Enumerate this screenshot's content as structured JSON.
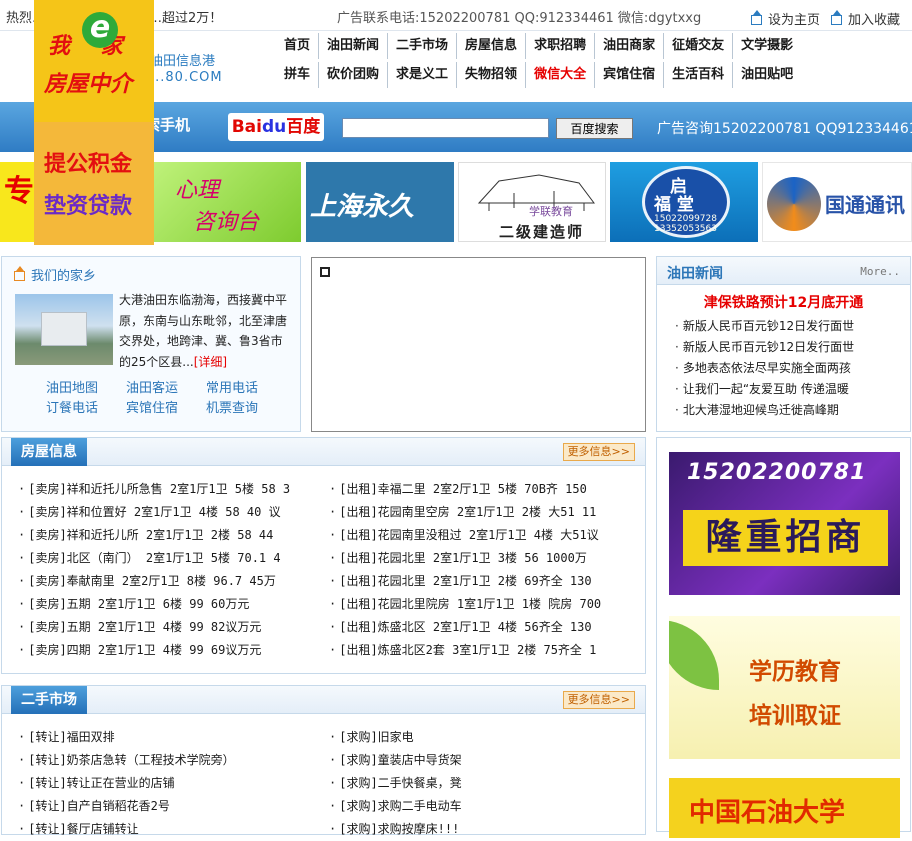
{
  "topbar": {
    "notice": "热烈…………………………超过2万！",
    "contact": "广告联系电话:15202200781 QQ:912334461 微信:dgytxxg",
    "set_home": "设为主页",
    "add_fav": "加入收藏"
  },
  "logo": {
    "name": "油田信息港",
    "domain": "...80.COM"
  },
  "nav": {
    "row1": [
      "首页",
      "油田新闻",
      "二手市场",
      "房屋信息",
      "求职招聘",
      "油田商家",
      "征婚交友",
      "文学摄影"
    ],
    "row2": [
      "拼车",
      "砍价团购",
      "求是义工",
      "失物招领",
      "微信大全",
      "宾馆住宿",
      "生活百科",
      "油田贴吧"
    ],
    "highlight_color": "#e60000"
  },
  "search": {
    "phone_label": "百度搜索手机",
    "baidu_label_1": "Bai",
    "baidu_label_2": "du",
    "baidu_label_3": "百度",
    "placeholder": "",
    "button": "百度搜索",
    "ad": "广告咨询15202200781 QQ912334461"
  },
  "float_ad": {
    "line1": "我",
    "e": "e",
    "line1b": "家",
    "line2": "房屋中介",
    "line3": "提公积金",
    "line4": "垫资贷款"
  },
  "banners": {
    "b1": "专",
    "b2_1": "心理",
    "b2_2": "咨询台",
    "b3": "上海永久",
    "b4_1": "学联教育",
    "b4_2": "二级建造师",
    "b5_1": "启",
    "b5_2": "福 堂",
    "b5_3": "15022099728 13352053563",
    "b6": "国通通讯"
  },
  "hometown": {
    "title": "我们的家乡",
    "intro": "大港油田东临渤海，西接冀中平原，东南与山东毗邻，北至津唐交界处，地跨津、冀、鲁3省市的25个区县...",
    "more": "[详细]",
    "links": [
      "油田地图",
      "油田客运",
      "常用电话",
      "订餐电话",
      "宾馆住宿",
      "机票查询"
    ]
  },
  "news": {
    "title": "油田新闻",
    "more": "More..",
    "headline": "津保铁路预计12月底开通",
    "items": [
      "新版人民币百元钞12日发行面世",
      "新版人民币百元钞12日发行面世",
      "多地表态依法尽早实施全面两孩",
      "让我们一起“友爱互助 传递温暖",
      "北大港湿地迎候鸟迁徙高峰期"
    ]
  },
  "house": {
    "title": "房屋信息",
    "more": "更多信息>>",
    "col1": [
      "[卖房]祥和近托儿所急售 2室1厅1卫 5楼 58 3",
      "[卖房]祥和位置好 2室1厅1卫 4楼 58 40 议",
      "[卖房]祥和近托儿所 2室1厅1卫 2楼 58 44",
      "[卖房]北区（南门） 2室1厅1卫 5楼 70.1 4",
      "[卖房]奉献南里 2室2厅1卫 8楼 96.7 45万",
      "[卖房]五期 2室1厅1卫 6楼 99 60万元",
      "[卖房]五期 2室1厅1卫 4楼 99 82议万元",
      "[卖房]四期 2室1厅1卫 4楼 99 69议万元"
    ],
    "col2": [
      "[出租]幸福二里 2室2厅1卫 5楼 70B齐 150",
      "[出租]花园南里空房 2室1厅1卫 2楼 大51 11",
      "[出租]花园南里没租过 2室1厅1卫 4楼 大51议",
      "[出租]花园北里 2室1厅1卫 3楼 56 1000万",
      "[出租]花园北里 2室1厅1卫 2楼 69齐全 130",
      "[出租]花园北里院房 1室1厅1卫 1楼 院房 700",
      "[出租]炼盛北区 2室1厅1卫 4楼 56齐全 130",
      "[出租]炼盛北区2套 3室1厅1卫 2楼 75齐全 1"
    ]
  },
  "market": {
    "title": "二手市场",
    "more": "更多信息>>",
    "col1": [
      "[转让]福田双排",
      "[转让]奶茶店急转（工程技术学院旁）",
      "[转让]转让正在营业的店铺",
      "[转让]自产自销稻花香2号",
      "[转让]餐厅店铺转让"
    ],
    "col2": [
      "[求购]旧家电",
      "[求购]童装店中导货架",
      "[求购]二手快餐桌，凳",
      "[求购]求购二手电动车",
      "[求购]求购按摩床!!!"
    ]
  },
  "side_ads": {
    "ad1_phone": "15202200781",
    "ad1_text": "隆重招商",
    "ad2_1": "学历教育",
    "ad2_2": "培训取证",
    "ad3": "中国石油大学"
  }
}
